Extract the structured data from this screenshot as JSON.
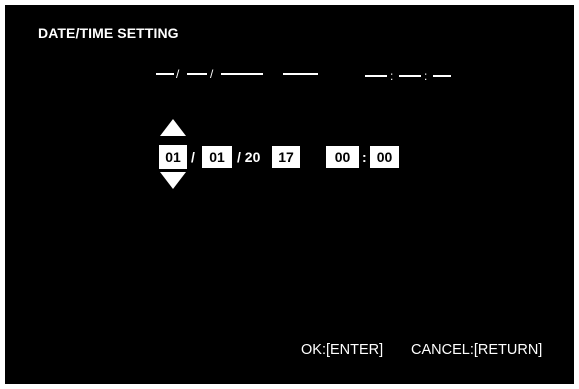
{
  "menu": {
    "title": "DATE/TIME SETTING"
  },
  "current_display": {
    "date_sep_1": "/",
    "date_sep_2": "/",
    "time_sep_1": ":",
    "time_sep_2": ":"
  },
  "editor": {
    "month": "01",
    "date_sep_1": "/",
    "day": "01",
    "year_prefix": "/ 20",
    "year_suffix": "17",
    "hour": "00",
    "time_sep": ":",
    "minute": "00",
    "selected_field": "month"
  },
  "footer": {
    "ok_hint": "OK:[ENTER]",
    "cancel_hint": "CANCEL:[RETURN]"
  },
  "colors": {
    "background": "#000000",
    "text": "#ffffff",
    "field_bg": "#ffffff",
    "field_text": "#000000"
  },
  "icons": {
    "up": "triangle-up-icon",
    "down": "triangle-down-icon"
  }
}
